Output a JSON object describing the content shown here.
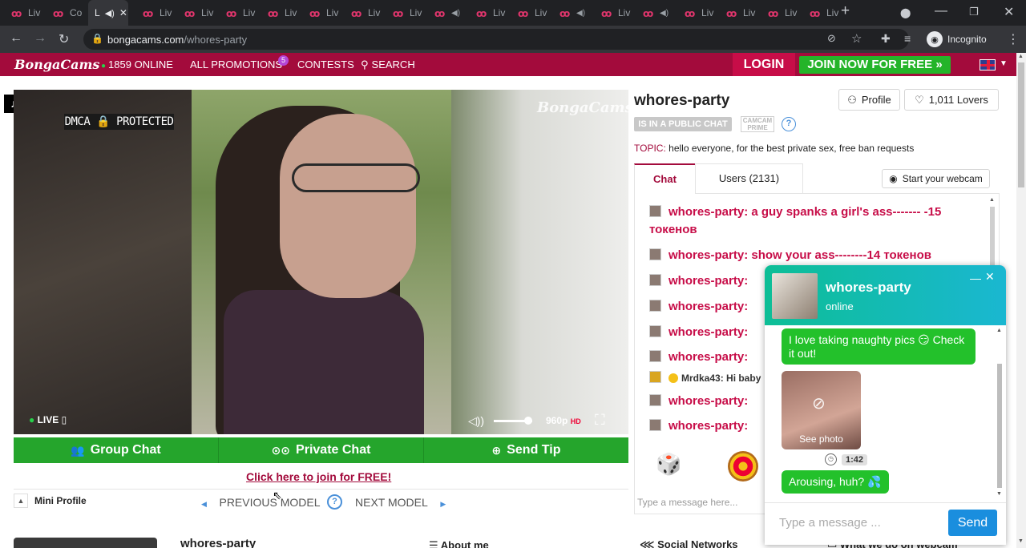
{
  "browser": {
    "tabs": [
      {
        "label": "Liv"
      },
      {
        "label": "Co"
      },
      {
        "label": "L"
      },
      {
        "label": "Liv"
      },
      {
        "label": "Liv"
      },
      {
        "label": "Liv"
      },
      {
        "label": "Liv"
      },
      {
        "label": "Liv"
      },
      {
        "label": "Liv"
      },
      {
        "label": "Liv"
      },
      {
        "label": "Liv"
      },
      {
        "label": "Liv"
      },
      {
        "label": "Liv"
      },
      {
        "label": "Liv"
      },
      {
        "label": "Liv"
      },
      {
        "label": "Liv"
      },
      {
        "label": "Liv"
      },
      {
        "label": "Liv"
      },
      {
        "label": "Liv"
      },
      {
        "label": "Liv"
      }
    ],
    "url_host": "bongacams.com",
    "url_path": "/whores-party",
    "incognito_label": "Incognito"
  },
  "site": {
    "logo": "BongaCams",
    "online": "1859 ONLINE",
    "promotions": "ALL PROMOTIONS",
    "promotions_badge": "5",
    "contests": "CONTESTS",
    "search": "SEARCH",
    "login": "LOGIN",
    "join": "JOIN NOW FOR FREE »"
  },
  "video": {
    "dmca": "DMCA 🔒 PROTECTED",
    "watermark": "BongaCams",
    "live": "LIVE",
    "quality": "960p",
    "hd": "HD",
    "volume_level": 0.9
  },
  "actions": {
    "group_chat": "Group Chat",
    "private_chat": "Private Chat",
    "send_tip": "Send Tip",
    "join_free": "Click here to join for FREE!",
    "mini_profile": "Mini Profile",
    "previous_model": "PREVIOUS MODEL",
    "next_model": "NEXT MODEL"
  },
  "bottom": {
    "name": "whores-party",
    "about_me": "About me",
    "social": "Social Networks",
    "what_we_do": "What we do on webcam"
  },
  "model": {
    "name": "whores-party",
    "profile_btn": "Profile",
    "lovers_btn": "1,011 Lovers",
    "status": "IS IN A PUBLIC CHAT",
    "prime": "CAMCAM PRIME",
    "topic_label": "TOPIC:",
    "topic": "hello everyone, for the best private sex, free ban requests"
  },
  "chat": {
    "tab_chat": "Chat",
    "tab_users": "Users (2131)",
    "start_webcam": "Start your webcam",
    "messages": [
      {
        "text": "whores-party: a guy spanks a girl's ass------- -15 токенов"
      },
      {
        "text": "whores-party: show your ass--------14 токенов"
      },
      {
        "text": "whores-party:"
      },
      {
        "text": "whores-party:"
      },
      {
        "text": "whores-party:"
      },
      {
        "text": "whores-party:"
      },
      {
        "text": "Mrdka43: Hi baby"
      },
      {
        "text": "whores-party:"
      },
      {
        "text": "whores-party:"
      }
    ],
    "input_placeholder": "Type a message here..."
  },
  "popup": {
    "name": "whores-party",
    "status": "online",
    "msg1": "I love taking naughty pics 😏 Check it out!",
    "see_photo": "See photo",
    "timer": "1:42",
    "msg2": "Arousing, huh? 💦",
    "input_placeholder": "Type a message ...",
    "send": "Send"
  }
}
